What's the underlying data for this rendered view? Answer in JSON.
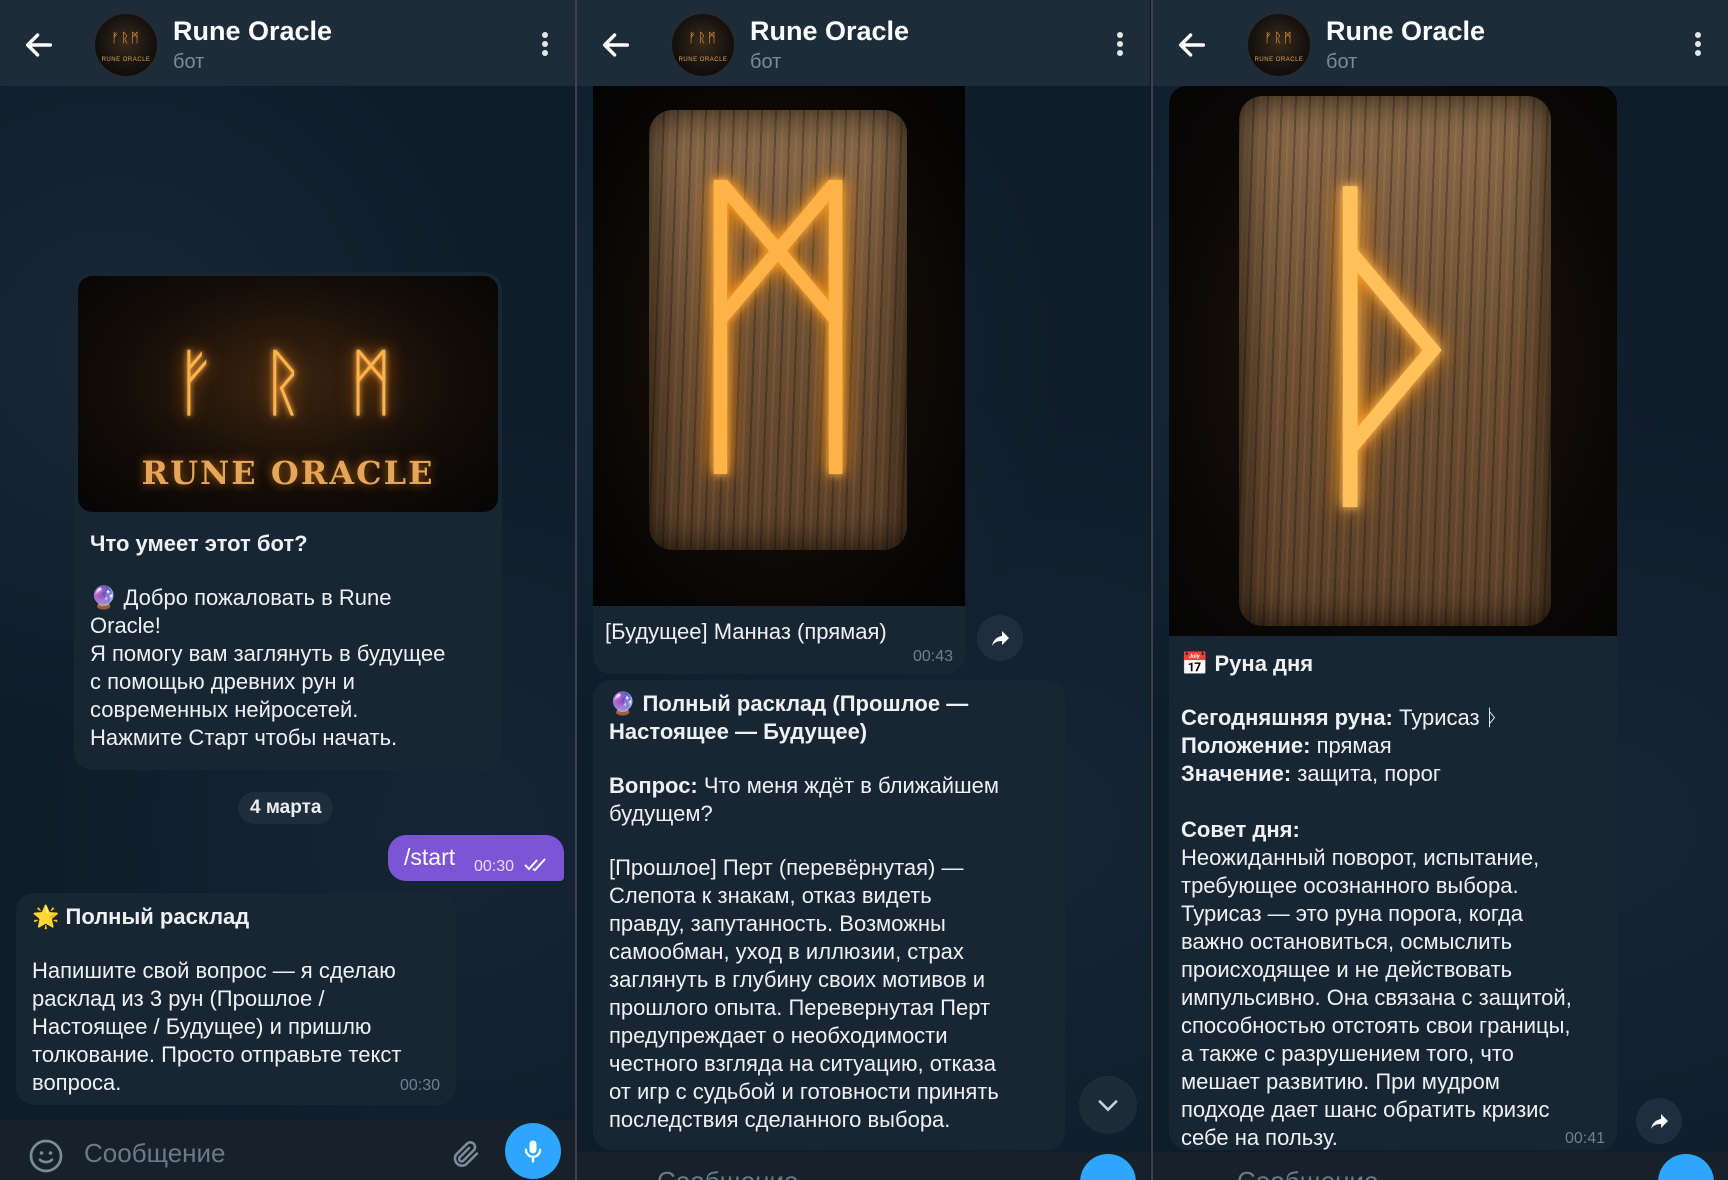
{
  "header": {
    "title": "Rune Oracle",
    "subtitle": "бот"
  },
  "screen1": {
    "banner": {
      "runes": "ᚠ ᚱ ᛗ",
      "text": "RUNE ORACLE"
    },
    "intro_title": "Что умеет этот бот?",
    "intro_body": "🔮 Добро пожаловать в Rune\nOracle!\nЯ помогу вам заглянуть в будущее\nс помощью древних рун и\nсовременных нейросетей.\nНажмите Старт чтобы начать.",
    "date": "4 марта",
    "out_msg": {
      "text": "/start",
      "time": "00:30"
    },
    "reply": {
      "title": "🌟 Полный расклад",
      "body": "Напишите свой вопрос — я сделаю\nрасклад из 3 рун (Прошлое /\nНастоящее / Будущее) и пришлю\nтолкование. Просто отправьте текст\nвопроса.",
      "time": "00:30"
    },
    "input_placeholder": "Сообщение"
  },
  "screen2": {
    "caption": "[Будущее] Манназ (прямая)",
    "caption_time": "00:43",
    "rune_glyph": "ᛗ",
    "reading_title": "🔮 Полный расклад (Прошлое —\nНастоящее — Будущее)",
    "question_label": "Вопрос:",
    "question_text": " Что меня ждёт в ближайшем\nбудущем?",
    "past_text": "[Прошлое] Перт (перевёрнутая) —\nСлепота к знакам, отказ видеть\nправду, запутанность. Возможны\nсамообман, уход в иллюзии, страх\nзаглянуть в глубину своих мотивов и\nпрошлого опыта. Перевернутая Перт\nпредупреждает о необходимости\nчестного взгляда на ситуацию, отказа\nот игр с судьбой и готовности принять\nпоследствия сделанного выбора.",
    "input_placeholder": "Сообщение"
  },
  "screen3": {
    "rune_glyph": "ᚦ",
    "title": "📅 Руна дня",
    "rune_label": "Сегодняшняя руна:",
    "rune_value": " Турисаз ᚦ",
    "pos_label": "Положение:",
    "pos_value": " прямая",
    "mean_label": "Значение:",
    "mean_value": " защита, порог",
    "advice_label": "Совет дня:",
    "advice_text": "Неожиданный поворот, испытание,\nтребующее осознанного выбора.\nТурисаз — это руна порога, когда\nважно остановиться, осмыслить\nпроисходящее и не действовать\nимпульсивно. Она связана с защитой,\nспособностью отстоять свои границы,\nа также с разрушением того, что\nмешает развитию. При мудром\nподходе дает шанс обратить кризис\nсебе на пользу.",
    "time": "00:41",
    "input_placeholder": "Сообщение"
  },
  "colors": {
    "accent": "#2ea6ff",
    "outgoing": "#7b55d6",
    "bubble": "#182533",
    "header": "#1e2c3a"
  }
}
